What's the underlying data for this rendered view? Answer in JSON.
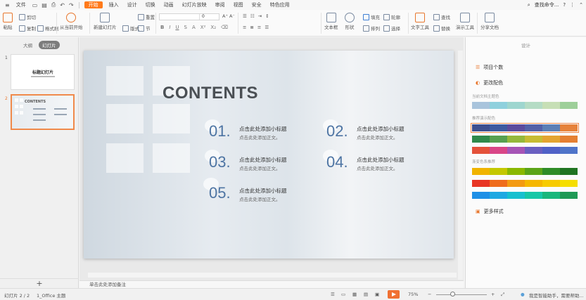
{
  "menubar": {
    "file": "文件",
    "tabs": [
      "开始",
      "插入",
      "设计",
      "切换",
      "动画",
      "幻灯片放映",
      "审阅",
      "视图",
      "安全",
      "特色应用"
    ],
    "active_tab": "开始",
    "search": "查找命令..."
  },
  "ribbon": {
    "paste": "粘贴",
    "cut": "剪切",
    "copy": "复制",
    "format_painter": "格式刷",
    "play_from_current": "从当前开始",
    "new_slide": "新建幻灯片",
    "layout": "版式",
    "section": "节",
    "reset": "重置",
    "font_size": "0",
    "text_box": "文本框",
    "shapes": "形状",
    "arrange": "排列",
    "replace": "替换",
    "select": "选择",
    "text_tools": "文字工具",
    "replace2": "替换",
    "smart_art": "演示工具",
    "share": "分享文档",
    "fill": "填充",
    "outline": "轮廓",
    "find": "查找"
  },
  "left_panel": {
    "tabs": [
      "大纲",
      "幻灯片"
    ],
    "active_tab": "幻灯片",
    "slide1_num": "1",
    "slide1_title": "标题幻灯片",
    "slide2_num": "2",
    "slide2_title": "CONTENTS",
    "add": "+"
  },
  "slide": {
    "title": "CONTENTS",
    "items": [
      {
        "num": "01.",
        "heading": "点击此处添加小标题",
        "sub": "点击此处添加正文。"
      },
      {
        "num": "02.",
        "heading": "点击此处添加小标题",
        "sub": "点击此处添加正文。"
      },
      {
        "num": "03.",
        "heading": "点击此处添加小标题",
        "sub": "点击此处添加正文。"
      },
      {
        "num": "04.",
        "heading": "点击此处添加小标题",
        "sub": "点击此处添加正文。"
      },
      {
        "num": "05.",
        "heading": "点击此处添加小标题",
        "sub": "点击此处添加正文。"
      }
    ]
  },
  "notes": "单击此处添加备注",
  "right_panel": {
    "title": "设计",
    "project_style": "项目个数",
    "change_color": "更改配色",
    "current_theme_label": "当前文档主题色",
    "recommended_label": "推荐演示配色",
    "gradient_label": "渐变色系推荐",
    "more_styles": "更多样式",
    "palettes": [
      [
        "#a9c4dc",
        "#8fd0dd",
        "#9fd6cf",
        "#b5dcc5",
        "#c7dfb6",
        "#9ecf9a"
      ],
      [
        "#3d4f8f",
        "#3e5aa0",
        "#5b4a9d",
        "#5260a8",
        "#5a7fb6",
        "#e6823a"
      ],
      [
        "#2f8a4b",
        "#57a050",
        "#95b83c",
        "#c7bc33",
        "#e3a431",
        "#e58032"
      ],
      [
        "#e4523a",
        "#d94687",
        "#a655b6",
        "#6a5fc1",
        "#5061c7",
        "#4f74c9"
      ],
      [
        "#f0b400",
        "#c4c800",
        "#8ab800",
        "#5ba418",
        "#2f8c27",
        "#1f7421"
      ],
      [
        "#e83525",
        "#ef6c1c",
        "#f39a12",
        "#f5b700",
        "#f7cb00",
        "#f5de00"
      ],
      [
        "#1e90e6",
        "#1ea9e2",
        "#17c0cf",
        "#17c7a7",
        "#19b77c",
        "#1e9a55"
      ]
    ]
  },
  "status": {
    "slide_info": "幻灯片 2 / 2",
    "theme": "1_Office 主题",
    "zoom": "75%",
    "assistant": "我是智能助手，需要帮助..."
  }
}
